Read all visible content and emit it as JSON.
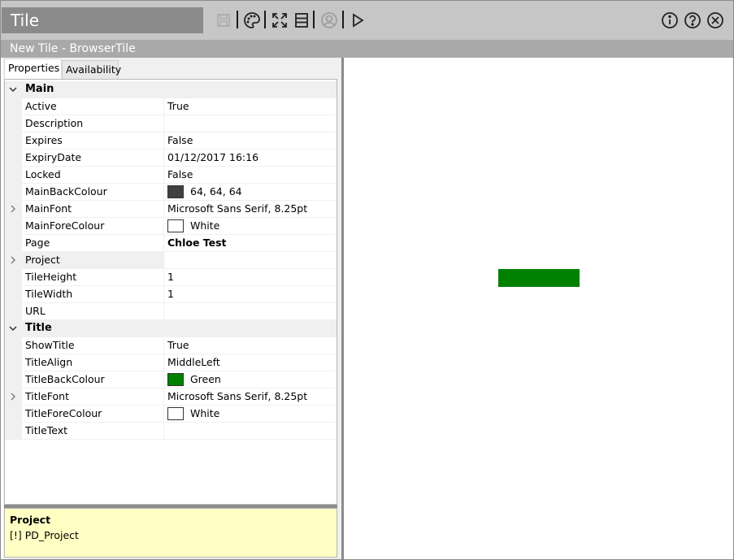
{
  "app": {
    "title": "Tile"
  },
  "subtitle": "New Tile - BrowserTile",
  "toolbar": {
    "icons": [
      "save-icon",
      "palette-icon",
      "fullscreen-icon",
      "layout-icon",
      "user-icon",
      "play-icon"
    ],
    "right_icons": [
      "info-icon",
      "help-icon",
      "close-icon"
    ]
  },
  "tabs": [
    {
      "label": "Properties",
      "active": true
    },
    {
      "label": "Availability",
      "active": false
    }
  ],
  "categories": {
    "main": {
      "label": "Main",
      "rows": [
        {
          "name": "Active",
          "value": "True"
        },
        {
          "name": "Description",
          "value": ""
        },
        {
          "name": "Expires",
          "value": "False"
        },
        {
          "name": "ExpiryDate",
          "value": "01/12/2017 16:16"
        },
        {
          "name": "Locked",
          "value": "False"
        },
        {
          "name": "MainBackColour",
          "value": "64, 64, 64",
          "swatch": "#404040"
        },
        {
          "name": "MainFont",
          "value": "Microsoft Sans Serif, 8.25pt",
          "expandable": true
        },
        {
          "name": "MainForeColour",
          "value": "White",
          "swatch": "#ffffff"
        },
        {
          "name": "Page",
          "value": "Chloe Test",
          "bold": true
        },
        {
          "name": "Project",
          "value": "",
          "expandable": true,
          "selected": true
        },
        {
          "name": "TileHeight",
          "value": "1"
        },
        {
          "name": "TileWidth",
          "value": "1"
        },
        {
          "name": "URL",
          "value": ""
        }
      ]
    },
    "title": {
      "label": "Title",
      "rows": [
        {
          "name": "ShowTitle",
          "value": "True"
        },
        {
          "name": "TitleAlign",
          "value": "MiddleLeft"
        },
        {
          "name": "TitleBackColour",
          "value": "Green",
          "swatch": "#008000"
        },
        {
          "name": "TitleFont",
          "value": "Microsoft Sans Serif, 8.25pt",
          "expandable": true
        },
        {
          "name": "TitleForeColour",
          "value": "White",
          "swatch": "#ffffff"
        },
        {
          "name": "TitleText",
          "value": ""
        }
      ]
    }
  },
  "help": {
    "title": "Project",
    "description": "[!] PD_Project"
  },
  "preview": {
    "tile_color": "#008000"
  },
  "colors": {
    "titlebar": "#c6c6c6",
    "app_title_bg": "#8a8a8a",
    "subtitle_bg": "#a9a9a9",
    "help_bg": "#ffffc4"
  }
}
